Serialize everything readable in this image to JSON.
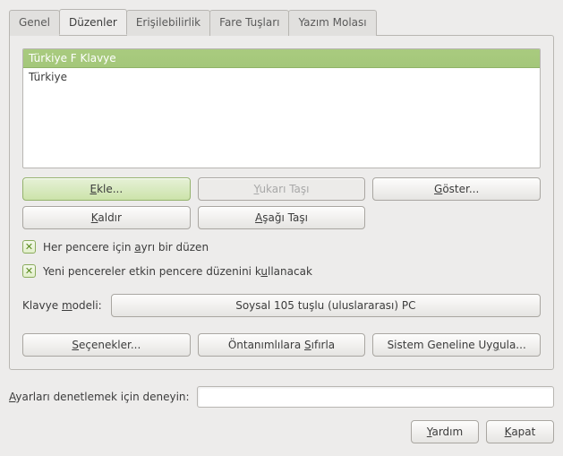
{
  "tabs": {
    "general": "Genel",
    "layouts": "Düzenler",
    "accessibility": "Erişilebilirlik",
    "mouse_keys": "Fare Tuşları",
    "typing_break": "Yazım Molası"
  },
  "layout_list": {
    "items": [
      {
        "name": "Türkiye F Klavye",
        "selected": true
      },
      {
        "name": "Türkiye",
        "selected": false
      }
    ]
  },
  "buttons": {
    "add_pre": "",
    "add_ul": "E",
    "add_post": "kle...",
    "move_up_pre": "",
    "move_up_ul": "Y",
    "move_up_post": "ukarı Taşı",
    "show_pre": "",
    "show_ul": "G",
    "show_post": "öster...",
    "remove_pre": "",
    "remove_ul": "K",
    "remove_post": "aldır",
    "move_down_pre": "",
    "move_down_ul": "A",
    "move_down_post": "şağı Taşı"
  },
  "checks": {
    "separate_pre": "Her pencere için ",
    "separate_ul": "a",
    "separate_post": "yrı bir düzen",
    "new_win_pre": "Yeni pencereler etkin pencere düzenini k",
    "new_win_ul": "u",
    "new_win_post": "llanacak"
  },
  "kb_model": {
    "label_pre": "Klavye ",
    "label_ul": "m",
    "label_post": "odeli:",
    "value": "Soysal 105 tuşlu (uluslararası) PC"
  },
  "actions": {
    "options_pre": "",
    "options_ul": "S",
    "options_post": "eçenekler...",
    "reset_pre": "Öntanımlılara ",
    "reset_ul": "S",
    "reset_post": "ıfırla",
    "apply_pre": "Sistem Geneline Uy",
    "apply_ul": "g",
    "apply_post": "ula..."
  },
  "test": {
    "label_pre": "",
    "label_ul": "A",
    "label_post": "yarları denetlemek için deneyin:",
    "value": ""
  },
  "footer": {
    "help_pre": "",
    "help_ul": "Y",
    "help_post": "ardım",
    "close_pre": "",
    "close_ul": "K",
    "close_post": "apat"
  }
}
